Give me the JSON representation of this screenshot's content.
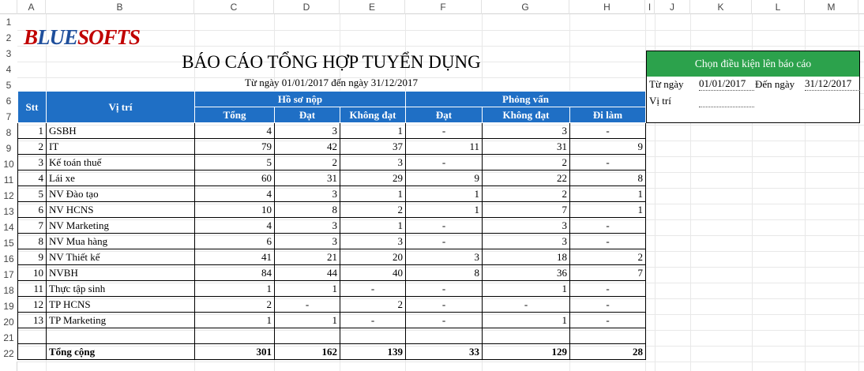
{
  "sheet": {
    "columns": [
      "A",
      "B",
      "C",
      "D",
      "E",
      "F",
      "G",
      "H",
      "I",
      "J",
      "K",
      "L",
      "M"
    ],
    "rows": [
      "1",
      "2",
      "3",
      "4",
      "5",
      "6",
      "7",
      "8",
      "9",
      "10",
      "11",
      "12",
      "13",
      "14",
      "15",
      "16",
      "17",
      "18",
      "19",
      "20",
      "21",
      "22"
    ]
  },
  "logo": {
    "part1": "B",
    "part2": "LUE",
    "part3": "SOFTS"
  },
  "report": {
    "title": "BÁO CÁO TỔNG HỢP TUYỂN DỤNG",
    "subtitle": "Từ ngày 01/01/2017 đến ngày 31/12/2017",
    "headers": {
      "stt": "Stt",
      "position": "Vị trí",
      "group_profile": "Hồ sơ nộp",
      "group_interview": "Phỏng vấn",
      "total": "Tổng",
      "passed": "Đạt",
      "failed": "Không đạt",
      "iv_passed": "Đạt",
      "iv_failed": "Không đạt",
      "working": "Đi làm"
    },
    "rows": [
      {
        "stt": "1",
        "pos": "GSBH",
        "total": "4",
        "passed": "3",
        "failed": "1",
        "ivp": "-",
        "ivf": "3",
        "work": "-"
      },
      {
        "stt": "2",
        "pos": "IT",
        "total": "79",
        "passed": "42",
        "failed": "37",
        "ivp": "11",
        "ivf": "31",
        "work": "9"
      },
      {
        "stt": "3",
        "pos": "Kế toán thuế",
        "total": "5",
        "passed": "2",
        "failed": "3",
        "ivp": "-",
        "ivf": "2",
        "work": "-"
      },
      {
        "stt": "4",
        "pos": "Lái xe",
        "total": "60",
        "passed": "31",
        "failed": "29",
        "ivp": "9",
        "ivf": "22",
        "work": "8"
      },
      {
        "stt": "5",
        "pos": "NV Đào tạo",
        "total": "4",
        "passed": "3",
        "failed": "1",
        "ivp": "1",
        "ivf": "2",
        "work": "1"
      },
      {
        "stt": "6",
        "pos": "NV HCNS",
        "total": "10",
        "passed": "8",
        "failed": "2",
        "ivp": "1",
        "ivf": "7",
        "work": "1"
      },
      {
        "stt": "7",
        "pos": "NV Marketing",
        "total": "4",
        "passed": "3",
        "failed": "1",
        "ivp": "-",
        "ivf": "3",
        "work": "-"
      },
      {
        "stt": "8",
        "pos": "NV Mua hàng",
        "total": "6",
        "passed": "3",
        "failed": "3",
        "ivp": "-",
        "ivf": "3",
        "work": "-"
      },
      {
        "stt": "9",
        "pos": "NV Thiết kế",
        "total": "41",
        "passed": "21",
        "failed": "20",
        "ivp": "3",
        "ivf": "18",
        "work": "2"
      },
      {
        "stt": "10",
        "pos": "NVBH",
        "total": "84",
        "passed": "44",
        "failed": "40",
        "ivp": "8",
        "ivf": "36",
        "work": "7"
      },
      {
        "stt": "11",
        "pos": "Thực tập sinh",
        "total": "1",
        "passed": "1",
        "failed": "-",
        "ivp": "-",
        "ivf": "1",
        "work": "-"
      },
      {
        "stt": "12",
        "pos": "TP HCNS",
        "total": "2",
        "passed": "-",
        "failed": "2",
        "ivp": "-",
        "ivf": "-",
        "work": "-"
      },
      {
        "stt": "13",
        "pos": "TP Marketing",
        "total": "1",
        "passed": "1",
        "failed": "-",
        "ivp": "-",
        "ivf": "1",
        "work": "-"
      }
    ],
    "totals": {
      "label": "Tổng cộng",
      "total": "301",
      "passed": "162",
      "failed": "139",
      "ivp": "33",
      "ivf": "129",
      "work": "28"
    }
  },
  "filter": {
    "title": "Chọn điều kiện lên báo cáo",
    "from_label": "Từ  ngày",
    "from_value": "01/01/2017",
    "to_label": "Đến ngày",
    "to_value": "31/12/2017",
    "position_label": "Vị trí",
    "position_value": ""
  },
  "colors": {
    "header_blue": "#1f6fc5",
    "filter_green": "#2ca24c",
    "logo_red": "#c00000",
    "logo_blue": "#1f4f9c"
  }
}
